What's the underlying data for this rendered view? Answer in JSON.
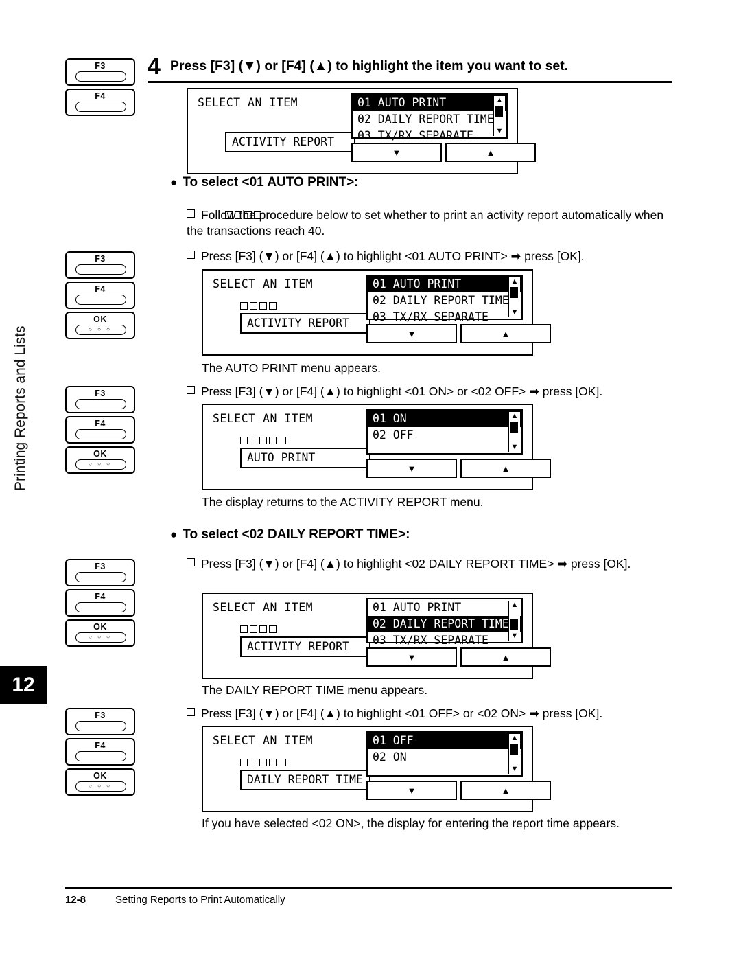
{
  "page": {
    "chapter_tab": "12",
    "vertical_title": "Printing Reports and Lists",
    "footer_number": "12-8",
    "footer_title": "Setting Reports to Print Automatically"
  },
  "step": {
    "number": "4",
    "text": "Press [F3] (▼) or [F4] (▲) to highlight the item you want to set."
  },
  "keys": {
    "f3": "F3",
    "f4": "F4",
    "ok": "OK",
    "ok_dots": "○ ○ ○"
  },
  "softkeys": {
    "down": "▼",
    "up": "▲"
  },
  "scrollbar": {
    "up": "▲",
    "down": "▼"
  },
  "lcd1": {
    "title": "SELECT AN ITEM",
    "field": "ACTIVITY REPORT",
    "list": [
      {
        "label": "01 AUTO PRINT",
        "selected": true
      },
      {
        "label": "02 DAILY REPORT TIME",
        "selected": false
      },
      {
        "label": "03 TX/RX SEPARATE",
        "selected": false
      }
    ]
  },
  "section1": {
    "heading": "To select <01 AUTO PRINT>:",
    "item1": "Follow the procedure below to set whether to print an activity report automatically when the transactions reach 40.",
    "item2": "Press [F3] (▼) or [F4] (▲) to highlight <01 AUTO PRINT> ➡ press [OK].",
    "caption1": "The AUTO PRINT menu appears.",
    "item3": "Press [F3] (▼) or [F4] (▲) to highlight <01 ON> or <02 OFF> ➡ press [OK].",
    "caption2": "The display returns to the ACTIVITY REPORT menu."
  },
  "lcd2": {
    "title": "SELECT AN ITEM",
    "field": "ACTIVITY REPORT",
    "list": [
      {
        "label": "01 AUTO PRINT",
        "selected": true
      },
      {
        "label": "02 DAILY REPORT TIME",
        "selected": false
      },
      {
        "label": "03 TX/RX SEPARATE",
        "selected": false
      }
    ]
  },
  "lcd3": {
    "title": "SELECT AN ITEM",
    "field": "AUTO PRINT",
    "list": [
      {
        "label": "01 ON",
        "selected": true
      },
      {
        "label": "02 OFF",
        "selected": false
      }
    ]
  },
  "section2": {
    "heading": "To select <02 DAILY REPORT TIME>:",
    "item1": "Press [F3] (▼) or [F4] (▲) to highlight <02 DAILY REPORT TIME> ➡ press [OK].",
    "caption1": "The DAILY REPORT TIME menu appears.",
    "item2": "Press [F3] (▼) or [F4] (▲) to highlight <01 OFF> or <02 ON> ➡ press [OK].",
    "caption2": "If you have selected <02 ON>, the display for entering the report time appears."
  },
  "lcd4": {
    "title": "SELECT AN ITEM",
    "field": "ACTIVITY REPORT",
    "list": [
      {
        "label": "01 AUTO PRINT",
        "selected": false
      },
      {
        "label": "02 DAILY REPORT TIME",
        "selected": true
      },
      {
        "label": "03 TX/RX SEPARATE",
        "selected": false
      }
    ]
  },
  "lcd5": {
    "title": "SELECT AN ITEM",
    "field": "DAILY REPORT TIME",
    "list": [
      {
        "label": "01 OFF",
        "selected": true
      },
      {
        "label": "02 ON",
        "selected": false
      }
    ]
  }
}
